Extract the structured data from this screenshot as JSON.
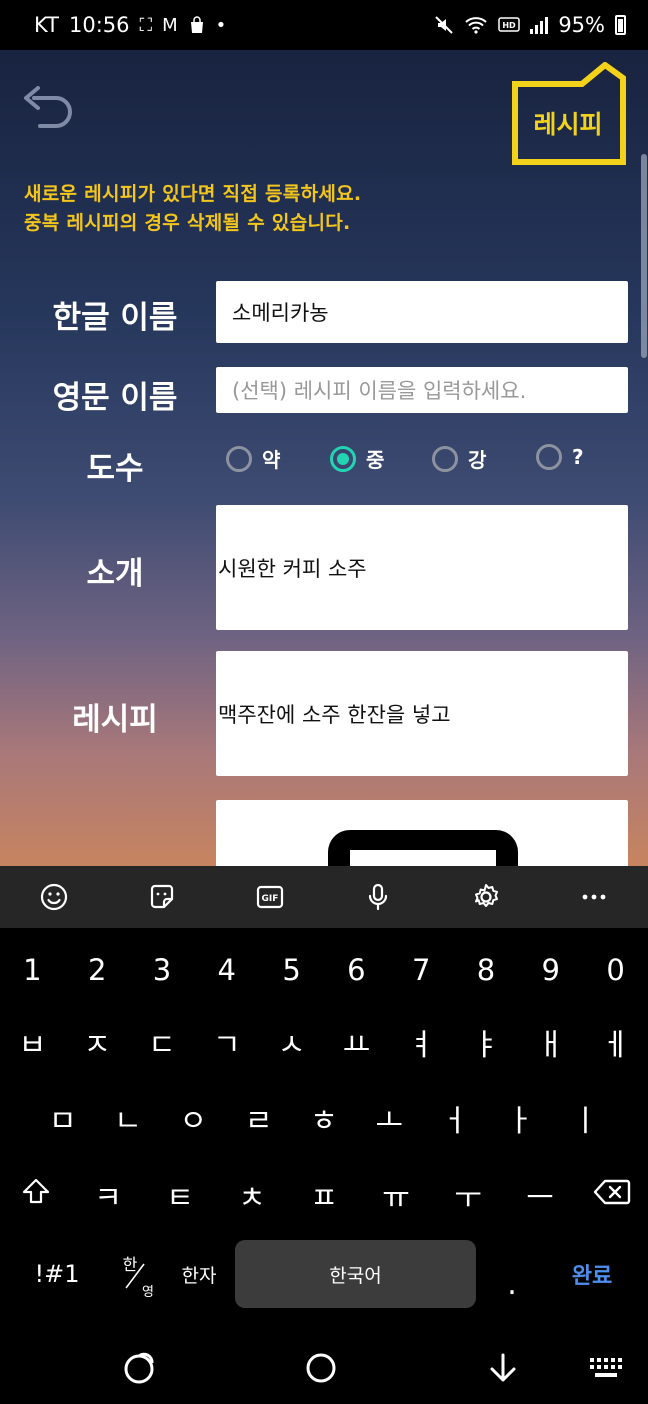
{
  "status_bar": {
    "carrier": "KT",
    "time": "10:56",
    "battery": "95%"
  },
  "app": {
    "logo_text": "레시피",
    "notice_line1": "새로운 레시피가 있다면 직접 등록하세요.",
    "notice_line2": "중복 레시피의 경우 삭제될 수 있습니다.",
    "accent_color": "#f4c61c",
    "radio_color": "#22d4b2",
    "form": {
      "korean_name_label": "한글 이름",
      "korean_name_value": "소메리카농",
      "english_name_label": "영문 이름",
      "english_name_placeholder": "(선택) 레시피 이름을 입력하세요.",
      "abv_label": "도수",
      "abv_options": [
        "약",
        "중",
        "강",
        "?"
      ],
      "abv_selected": "중",
      "intro_label": "소개",
      "intro_value": "시원한 커피 소주",
      "recipe_label": "레시피",
      "recipe_value": "맥주잔에 소주 한잔을 넣고"
    }
  },
  "keyboard": {
    "toolbar_icons": [
      "emoji-icon",
      "sticker-icon",
      "gif-icon",
      "microphone-icon",
      "settings-icon",
      "more-icon"
    ],
    "gif_label": "GIF",
    "numbers": [
      "1",
      "2",
      "3",
      "4",
      "5",
      "6",
      "7",
      "8",
      "9",
      "0"
    ],
    "row1": [
      "ㅂ",
      "ㅈ",
      "ㄷ",
      "ㄱ",
      "ㅅ",
      "ㅛ",
      "ㅕ",
      "ㅑ",
      "ㅐ",
      "ㅔ"
    ],
    "row2": [
      "ㅁ",
      "ㄴ",
      "ㅇ",
      "ㄹ",
      "ㅎ",
      "ㅗ",
      "ㅓ",
      "ㅏ",
      "ㅣ"
    ],
    "row3": [
      "ㅋ",
      "ㅌ",
      "ㅊ",
      "ㅍ",
      "ㅠ",
      "ㅜ",
      "ㅡ"
    ],
    "symbols_key": "!#1",
    "lang_toggle_top": "한",
    "lang_toggle_bottom": "영",
    "hanja_key": "한자",
    "space_label": "한국어",
    "period_key": ".",
    "done_key": "완료"
  }
}
